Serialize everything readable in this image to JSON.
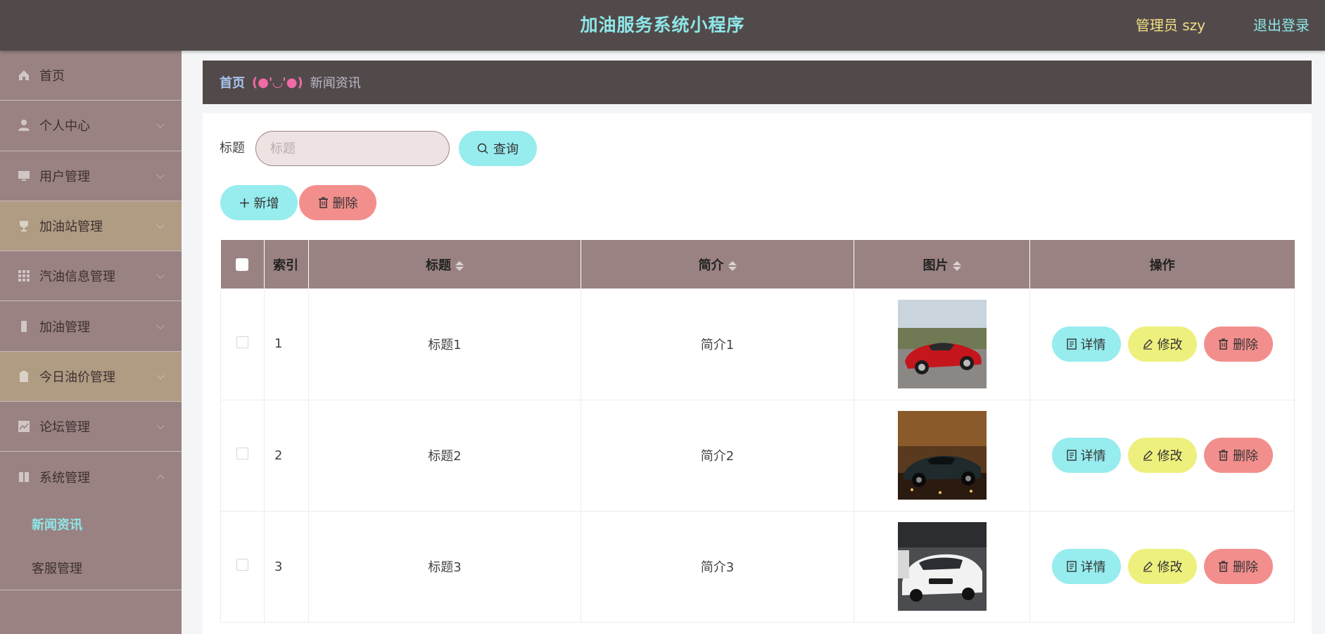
{
  "header": {
    "title": "加油服务系统小程序",
    "user_label": "管理员 szy",
    "logout_label": "退出登录",
    "title_color": "#8ee6e8",
    "user_color": "#f3df86"
  },
  "sidebar": {
    "items": [
      {
        "label": "首页",
        "icon": "home-icon"
      },
      {
        "label": "个人中心",
        "icon": "user-icon"
      },
      {
        "label": "用户管理",
        "icon": "monitor-icon"
      },
      {
        "label": "加油站管理",
        "icon": "trophy-icon"
      },
      {
        "label": "汽油信息管理",
        "icon": "grid-icon"
      },
      {
        "label": "加油管理",
        "icon": "phone-icon"
      },
      {
        "label": "今日油价管理",
        "icon": "clipboard-icon"
      },
      {
        "label": "论坛管理",
        "icon": "chart-icon"
      },
      {
        "label": "系统管理",
        "icon": "book-icon"
      }
    ],
    "sub_items": [
      {
        "label": "新闻资讯",
        "active": true
      },
      {
        "label": "客服管理",
        "active": false
      }
    ]
  },
  "breadcrumb": {
    "home": "首页",
    "separator": "(●'◡'●)",
    "current": "新闻资讯"
  },
  "search": {
    "label": "标题",
    "placeholder": "标题",
    "button_label": "查询"
  },
  "toolbar": {
    "add_label": "新增",
    "delete_label": "删除"
  },
  "table": {
    "headers": {
      "index": "索引",
      "title": "标题",
      "intro": "简介",
      "image": "图片",
      "actions": "操作"
    },
    "rows": [
      {
        "index": "1",
        "title": "标题1",
        "intro": "简介1",
        "image": "red-sports-car"
      },
      {
        "index": "2",
        "title": "标题2",
        "intro": "简介2",
        "image": "dark-sports-car"
      },
      {
        "index": "3",
        "title": "标题3",
        "intro": "简介3",
        "image": "white-sedan"
      }
    ],
    "row_actions": {
      "detail": "详情",
      "edit": "修改",
      "delete": "删除"
    }
  },
  "colors": {
    "topbar": "#524a4a",
    "sidebar": "#9a8282",
    "cyan_button": "#97ecee",
    "red_button": "#f28f8d",
    "yellow_button": "#eef07e"
  }
}
